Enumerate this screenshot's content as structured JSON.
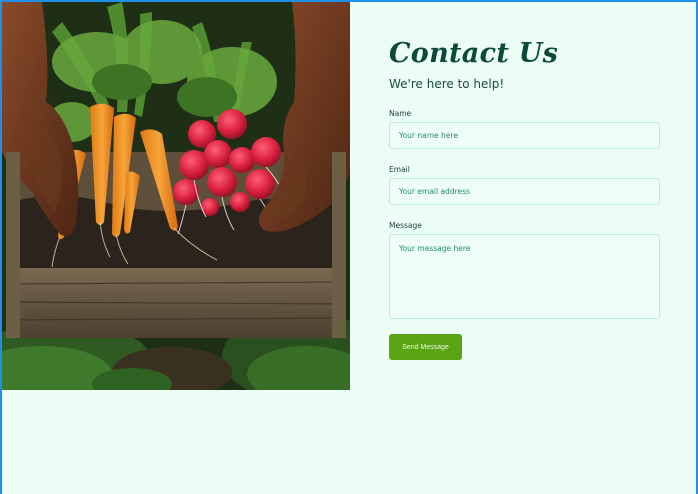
{
  "hero": {
    "image": "hands-holding-crate-of-carrots-and-radishes"
  },
  "contact": {
    "title": "Contact Us",
    "subtitle": "We're here to help!",
    "name_label": "Name",
    "name_placeholder": "Your name here",
    "email_label": "Email",
    "email_placeholder": "Your email address",
    "message_label": "Message",
    "message_placeholder": "Your message here",
    "submit_label": "Send Message"
  },
  "colors": {
    "background": "#ecfdf6",
    "title": "#0b4a3a",
    "button": "#5aa312",
    "input_border": "#bfeadb",
    "frame": "#1e90e8"
  }
}
